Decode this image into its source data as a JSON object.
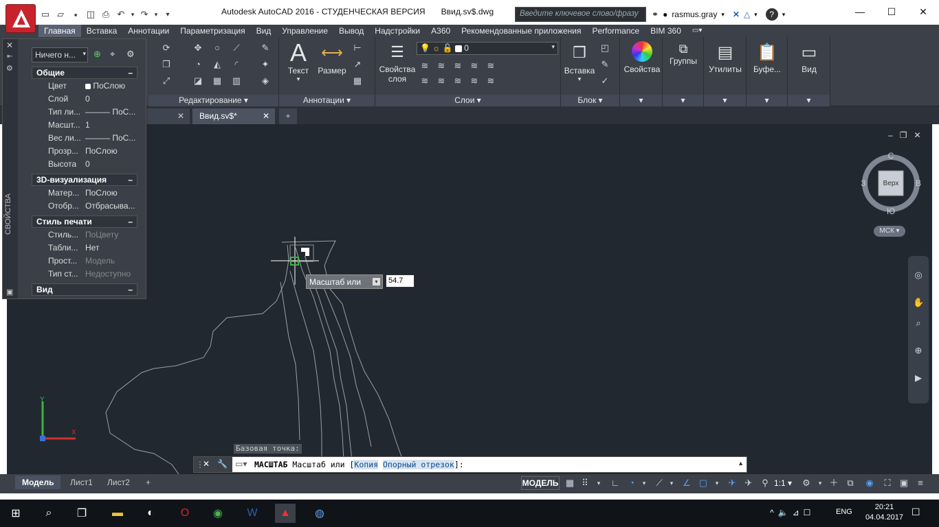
{
  "window": {
    "title": "Autodesk AutoCAD 2016 - СТУДЕНЧЕСКАЯ ВЕРСИЯ",
    "filename": "Ввид.sv$.dwg",
    "search_placeholder": "Введите ключевое слово/фразу",
    "user": "rasmus.gray"
  },
  "ribbon_tabs": [
    "Главная",
    "Вставка",
    "Аннотации",
    "Параметризация",
    "Вид",
    "Управление",
    "Вывод",
    "Надстройки",
    "А360",
    "Рекомендованные приложения",
    "Performance",
    "BIM 360"
  ],
  "panels": {
    "edit_title": "Редактирование",
    "annot_title": "Аннотации",
    "text_label": "Текст",
    "dim_label": "Размер",
    "layers_title": "Слои",
    "layer_props_label": "Свойства слоя",
    "layer_value": "0",
    "block_title": "Блок",
    "insert_label": "Вставка",
    "properties_label": "Свойства",
    "groups_label": "Группы",
    "utilities_label": "Утилиты",
    "clipboard_label": "Буфе...",
    "view_label": "Вид"
  },
  "doc_tabs": [
    "Ввид.sv$*"
  ],
  "props": {
    "vertical_label": "СВОЙСТВА",
    "selection": "Ничего н...",
    "sections": [
      "Общие",
      "3D-визуализация",
      "Стиль печати",
      "Вид"
    ],
    "general": [
      {
        "k": "Цвет",
        "v": "ПоСлою"
      },
      {
        "k": "Слой",
        "v": "0"
      },
      {
        "k": "Тип ли...",
        "v": "——— ПоС..."
      },
      {
        "k": "Масшт...",
        "v": "1"
      },
      {
        "k": "Вес ли...",
        "v": "——— ПоС..."
      },
      {
        "k": "Прозр...",
        "v": "ПоСлою"
      },
      {
        "k": "Высота",
        "v": "0"
      }
    ],
    "viz": [
      {
        "k": "Матер...",
        "v": "ПоСлою"
      },
      {
        "k": "Отобр...",
        "v": "Отбрасыва..."
      }
    ],
    "plot": [
      {
        "k": "Стиль...",
        "v": "ПоЦвету"
      },
      {
        "k": "Табли...",
        "v": "Нет"
      },
      {
        "k": "Прост...",
        "v": "Модель"
      },
      {
        "k": "Тип ст...",
        "v": "Недоступно"
      }
    ]
  },
  "viewcube": {
    "n": "С",
    "s": "Ю",
    "e": "В",
    "w": "З",
    "face": "Верх",
    "ucs": "МСК"
  },
  "dynamic_input": {
    "label": "Масштаб или",
    "value": "54.7"
  },
  "command": {
    "history": "Базовая точка:",
    "name": "МАСШТАБ",
    "prompt": "Масштаб или [",
    "opt1": "Копия",
    "opt2": "Опорный отрезок",
    "end": "]:"
  },
  "layouts": [
    "Модель",
    "Лист1",
    "Лист2"
  ],
  "status": {
    "model": "МОДЕЛЬ",
    "scale": "1:1"
  },
  "clock": {
    "time": "20:21",
    "date": "04.04.2017",
    "lang": "ENG"
  }
}
